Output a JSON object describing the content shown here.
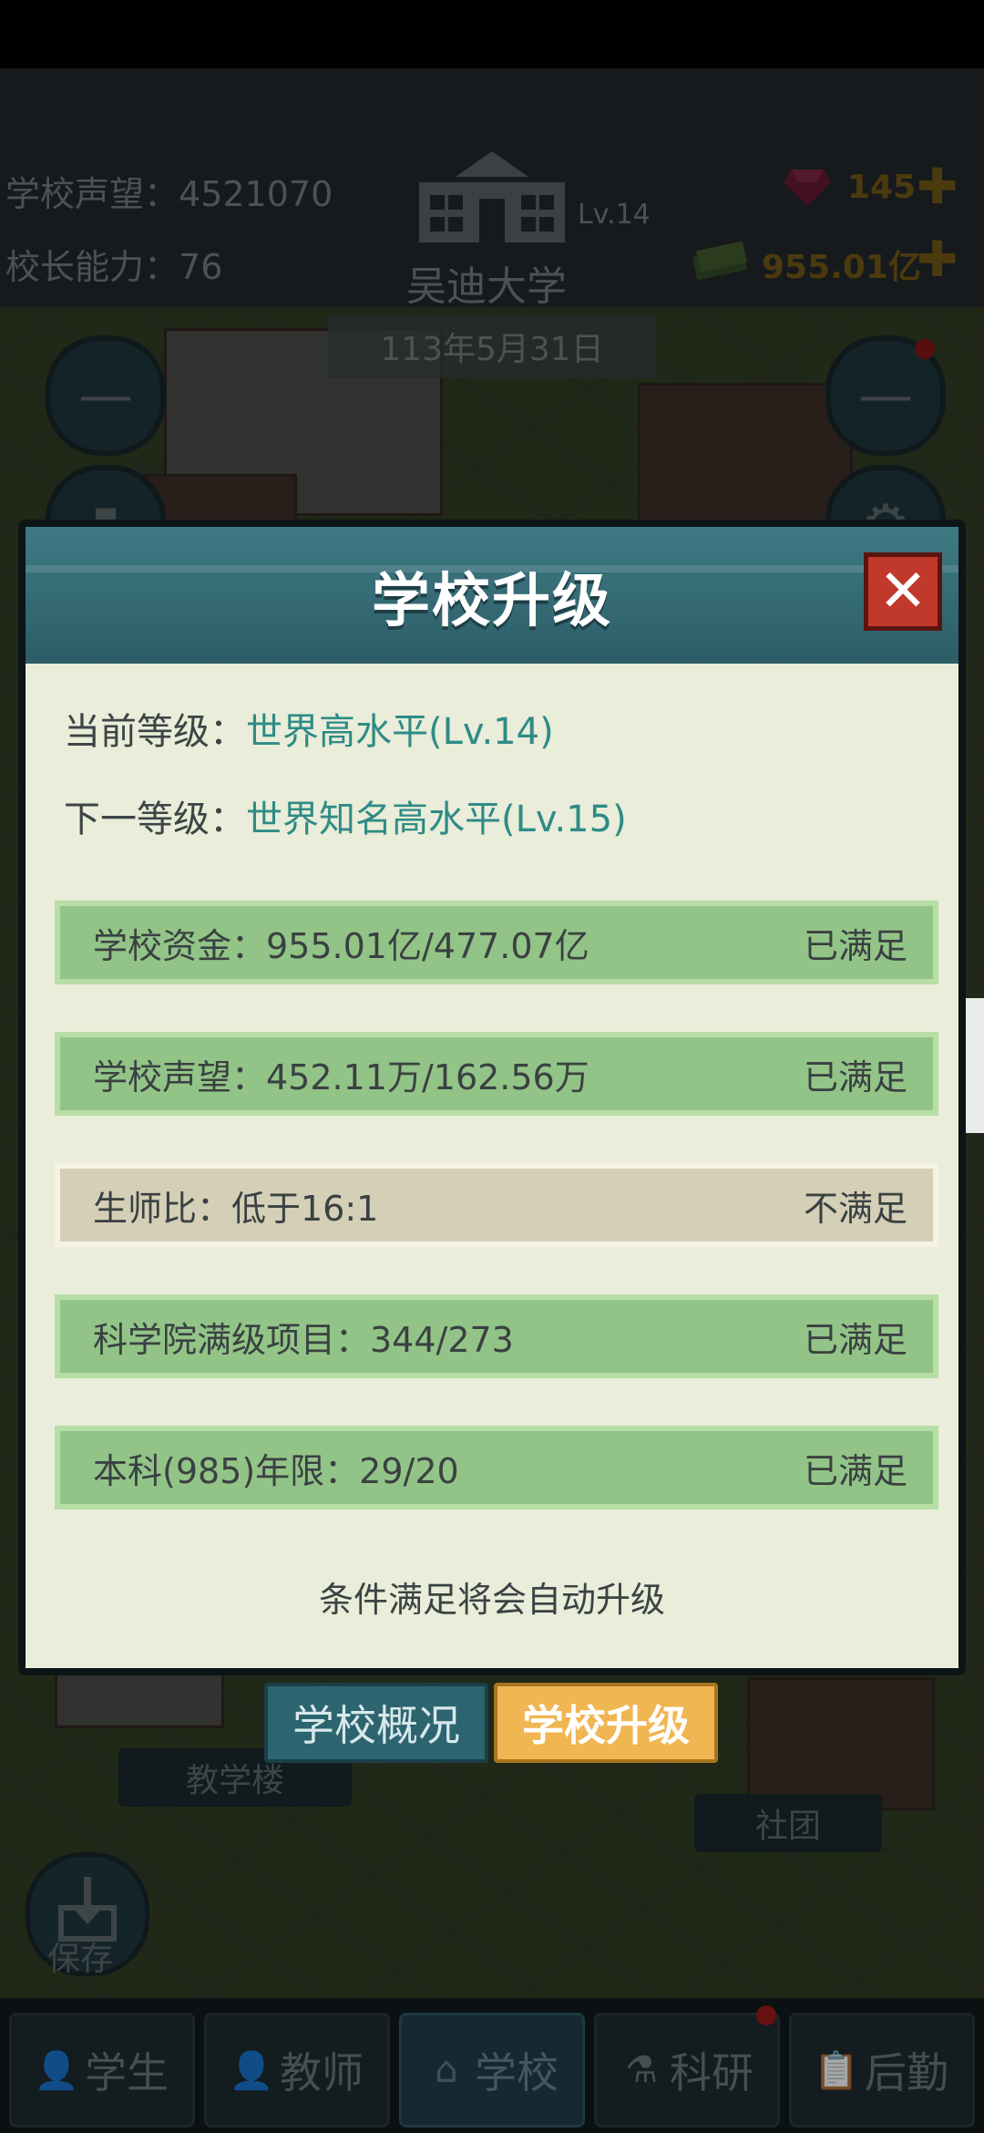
{
  "header": {
    "reputation_label": "学校声望：",
    "reputation_value": "4521070",
    "ability_label": "校长能力：",
    "ability_value": "76",
    "school_level": "Lv.14",
    "school_name": "吴迪大学",
    "date": "113年5月31日",
    "gems": "145",
    "money": "955.01亿"
  },
  "map": {
    "teaching_building": "教学楼",
    "club": "社团",
    "save": "保存"
  },
  "modal": {
    "title": "学校升级",
    "close_icon": "close-icon",
    "current_level_label": "当前等级：",
    "current_level_value": "世界高水平(Lv.14)",
    "next_level_label": "下一等级：",
    "next_level_value": "世界知名高水平(Lv.15)",
    "requirements": [
      {
        "label": "学校资金：955.01亿/477.07亿",
        "status": "已满足",
        "met": true
      },
      {
        "label": "学校声望：452.11万/162.56万",
        "status": "已满足",
        "met": true
      },
      {
        "label": "生师比：低于16:1",
        "status": "不满足",
        "met": false
      },
      {
        "label": "科学院满级项目：344/273",
        "status": "已满足",
        "met": true
      },
      {
        "label": "本科(985)年限：29/20",
        "status": "已满足",
        "met": true
      }
    ],
    "note": "条件满足将会自动升级"
  },
  "tabs": {
    "overview": "学校概况",
    "upgrade": "学校升级"
  },
  "nav": [
    {
      "label": "学生",
      "icon": "student-icon"
    },
    {
      "label": "教师",
      "icon": "teacher-icon"
    },
    {
      "label": "学校",
      "icon": "school-icon"
    },
    {
      "label": "科研",
      "icon": "research-icon"
    },
    {
      "label": "后勤",
      "icon": "logistics-icon"
    }
  ],
  "colors": {
    "met_bg": "#93c487",
    "unmet_bg": "#d4cfb6",
    "accent_teal": "#2e8b86",
    "title_bar": "#3f7a84",
    "close_red": "#c0392b",
    "tab_orange": "#f0b652"
  }
}
